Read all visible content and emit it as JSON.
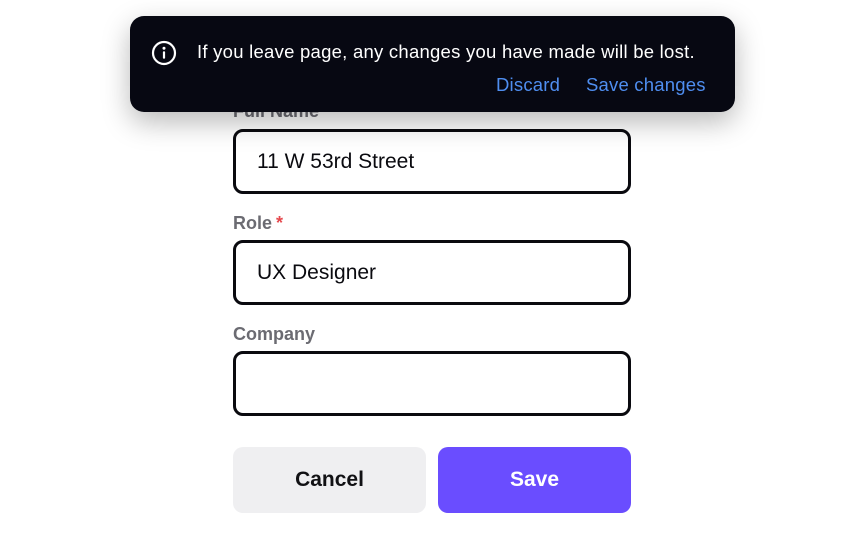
{
  "form": {
    "full_name": {
      "label": "Full Name",
      "value": "11 W 53rd Street"
    },
    "role": {
      "label": "Role",
      "required_mark": "*",
      "value": "UX Designer"
    },
    "company": {
      "label": "Company",
      "value": ""
    },
    "cancel_label": "Cancel",
    "save_label": "Save"
  },
  "toast": {
    "icon": "info-icon",
    "message": "If you leave page, any changes you have made will be lost.",
    "discard_label": "Discard",
    "save_changes_label": "Save changes"
  },
  "colors": {
    "primary": "#6a4dff",
    "toast_bg": "#070812",
    "link": "#4f8ef0",
    "required": "#e5484d"
  }
}
